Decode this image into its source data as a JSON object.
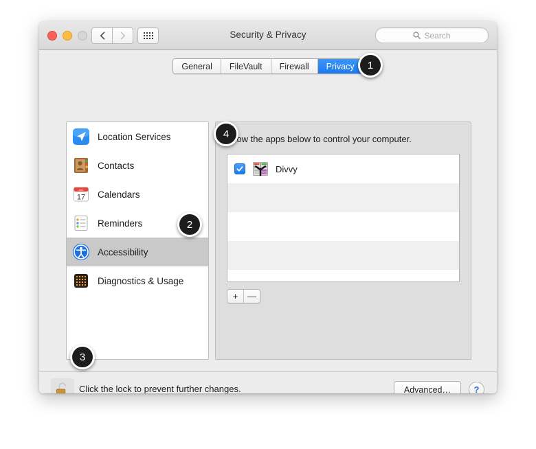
{
  "window": {
    "title": "Security & Privacy",
    "traffic_lights": [
      "close",
      "minimize",
      "zoom"
    ],
    "nav": {
      "back": "back-arrow",
      "forward": "forward-arrow",
      "show_all": "grid-icon"
    },
    "search": {
      "placeholder": "Search",
      "icon": "search-icon"
    }
  },
  "tabs": [
    {
      "label": "General",
      "active": false
    },
    {
      "label": "FileVault",
      "active": false
    },
    {
      "label": "Firewall",
      "active": false
    },
    {
      "label": "Privacy",
      "active": true
    }
  ],
  "sidebar": {
    "items": [
      {
        "label": "Location Services",
        "icon": "location-arrow-icon",
        "selected": false
      },
      {
        "label": "Contacts",
        "icon": "contacts-book-icon",
        "selected": false
      },
      {
        "label": "Calendars",
        "icon": "calendar-icon",
        "selected": false
      },
      {
        "label": "Reminders",
        "icon": "reminders-list-icon",
        "selected": false
      },
      {
        "label": "Accessibility",
        "icon": "accessibility-icon",
        "selected": true
      },
      {
        "label": "Diagnostics & Usage",
        "icon": "diagnostics-grid-icon",
        "selected": false
      }
    ]
  },
  "right_pane": {
    "caption": "Allow the apps below to control your computer.",
    "apps": [
      {
        "name": "Divvy",
        "checked": true,
        "icon": "divvy-app-icon"
      }
    ],
    "empty_rows": 4,
    "add_button": "+",
    "remove_button": "—"
  },
  "footer": {
    "lock_icon": "unlocked-padlock-icon",
    "lock_text": "Click the lock to prevent further changes.",
    "advanced_label": "Advanced…",
    "help_label": "?"
  },
  "callouts": [
    {
      "number": "1",
      "target": "privacy-tab"
    },
    {
      "number": "2",
      "target": "sidebar-item-accessibility"
    },
    {
      "number": "3",
      "target": "lock-button"
    },
    {
      "number": "4",
      "target": "app-divvy-checkbox"
    }
  ],
  "colors": {
    "accent_blue": "#1a7aee",
    "window_chrome": "#ececec",
    "selected_row": "#c9c9c9",
    "badge_bg": "#1c1c1c",
    "help_blue": "#2b6fd8"
  }
}
